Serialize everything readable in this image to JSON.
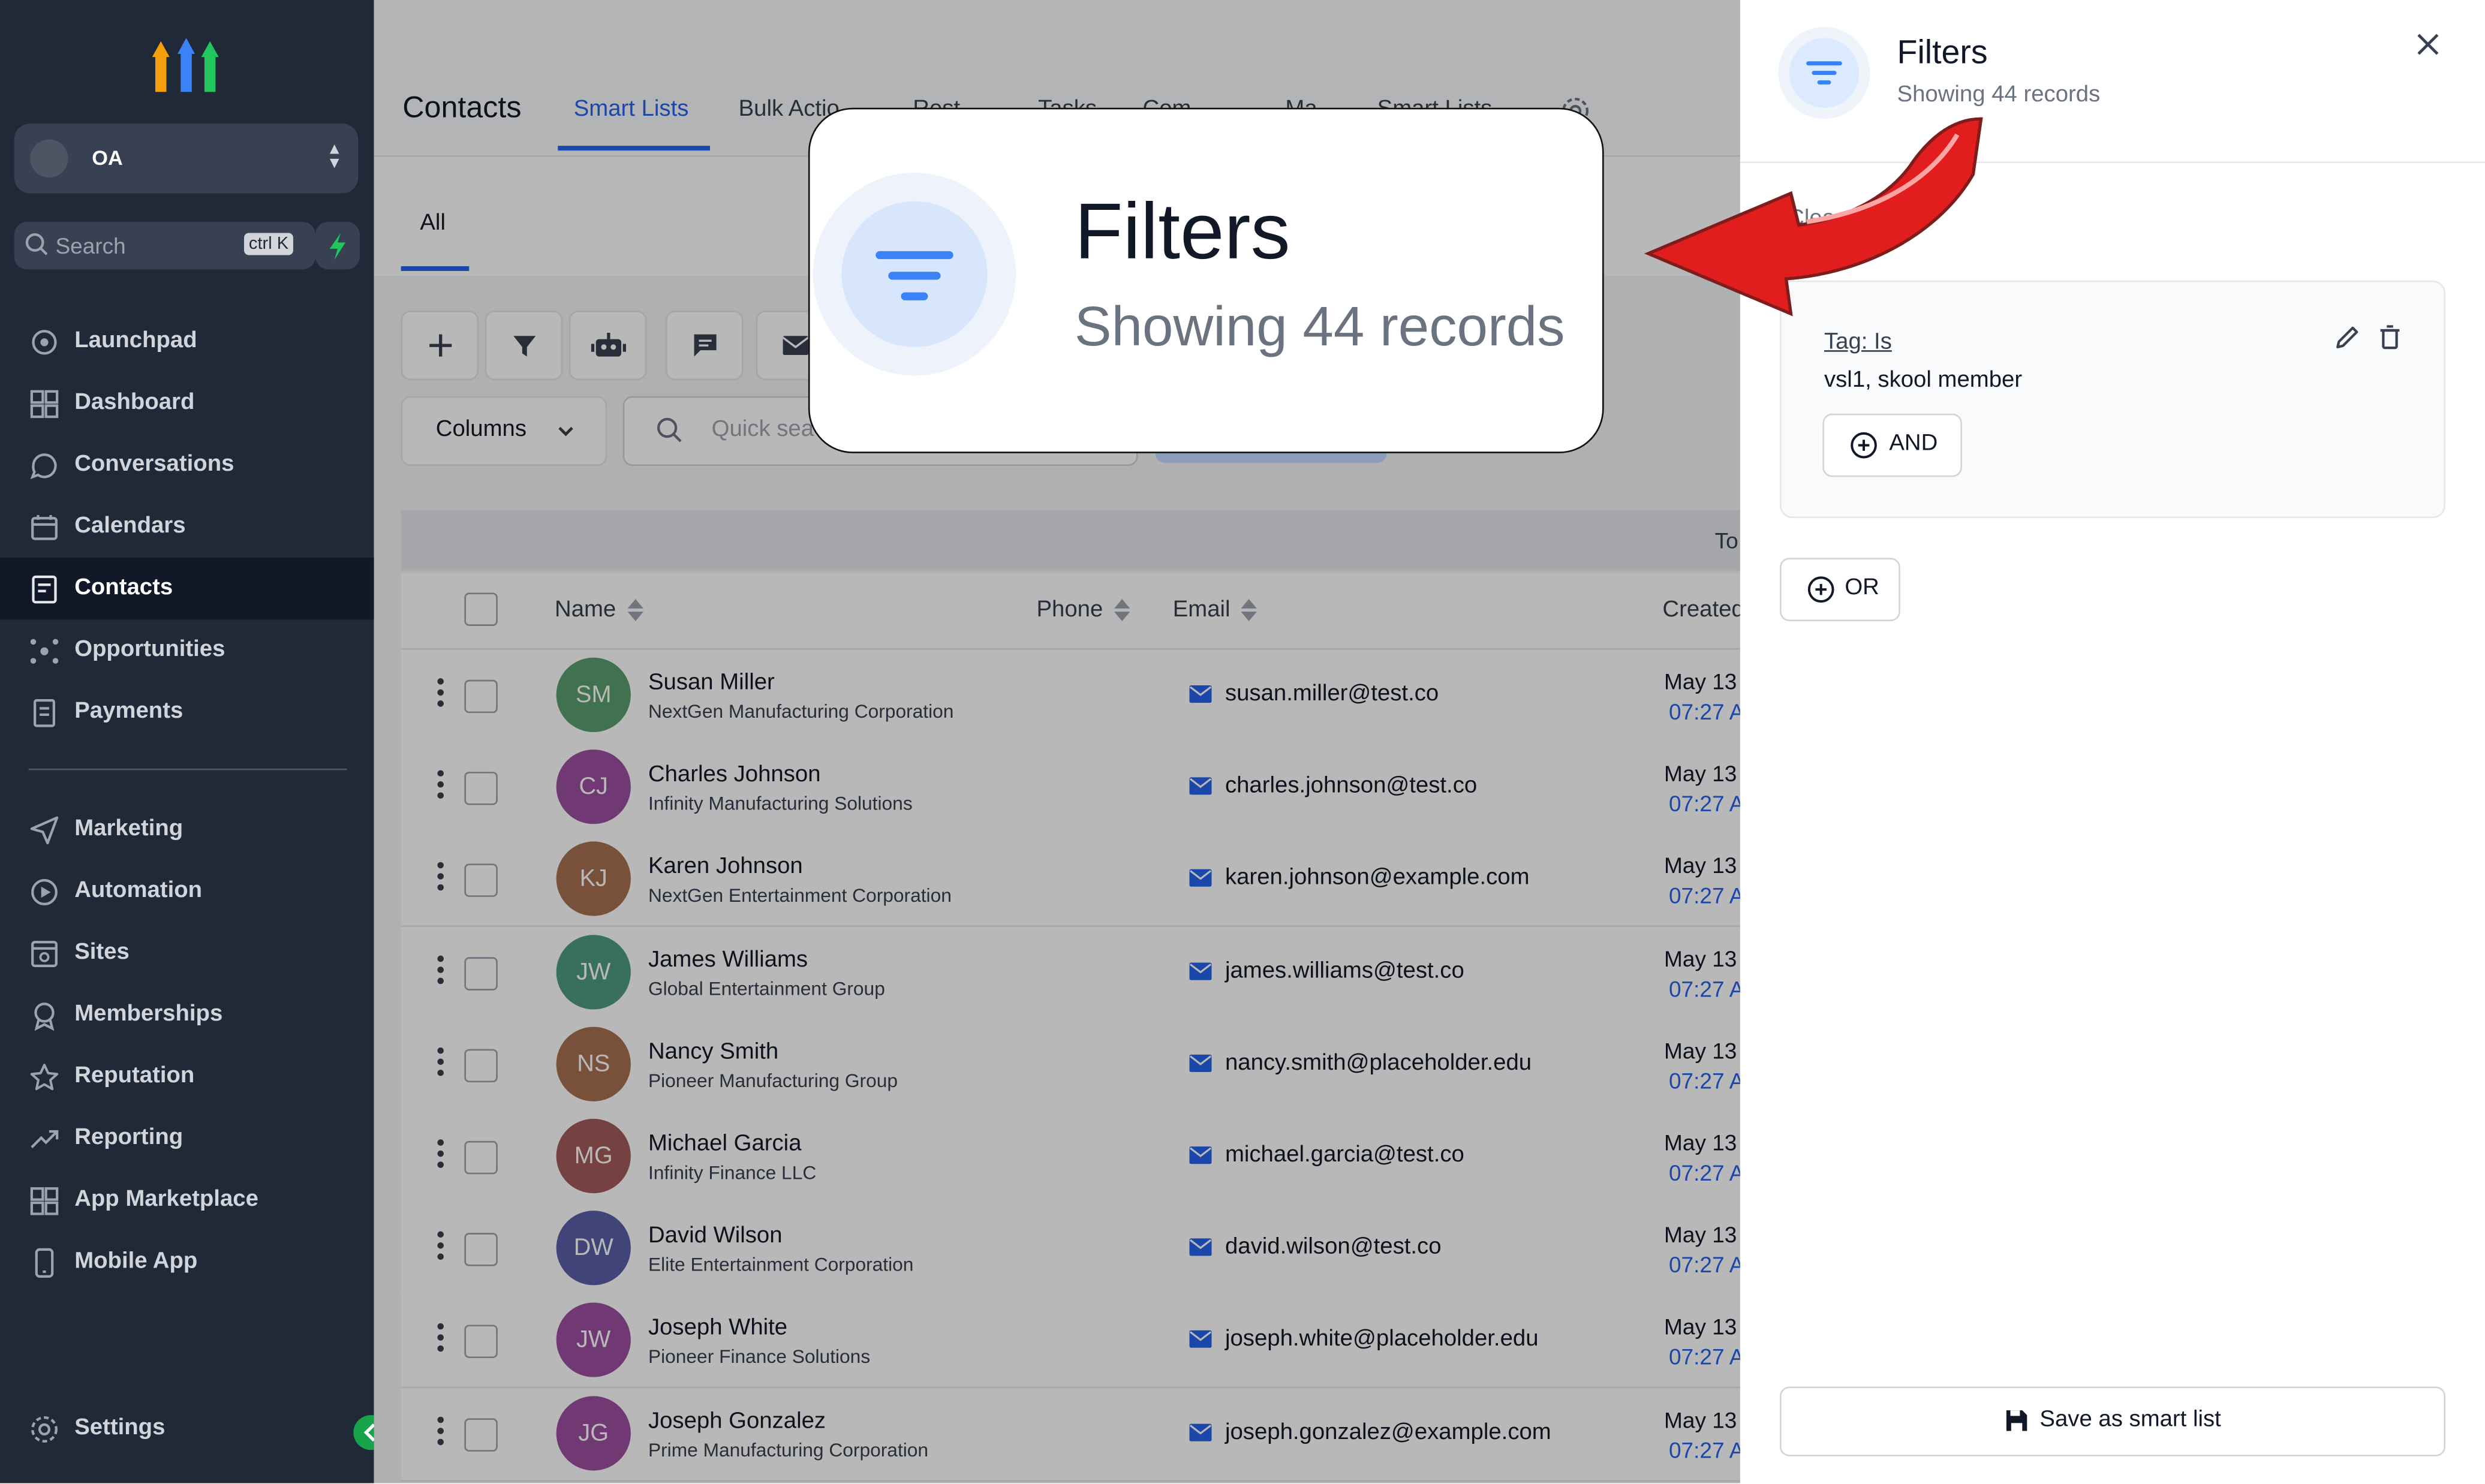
{
  "sidebar": {
    "account": "OA",
    "search_placeholder": "Search",
    "search_shortcut": "ctrl K",
    "items": [
      {
        "label": "Launchpad"
      },
      {
        "label": "Dashboard"
      },
      {
        "label": "Conversations"
      },
      {
        "label": "Calendars"
      },
      {
        "label": "Contacts"
      },
      {
        "label": "Opportunities"
      },
      {
        "label": "Payments"
      },
      {
        "label": "Marketing"
      },
      {
        "label": "Automation"
      },
      {
        "label": "Sites"
      },
      {
        "label": "Memberships"
      },
      {
        "label": "Reputation"
      },
      {
        "label": "Reporting"
      },
      {
        "label": "App Marketplace"
      },
      {
        "label": "Mobile App"
      }
    ],
    "settings": "Settings",
    "active_item": "Contacts"
  },
  "header": {
    "title": "Contacts",
    "tabs": [
      "Smart Lists",
      "Bulk Actio",
      "Rest",
      "Tasks",
      "Com",
      "Ma",
      "Smart Lists"
    ],
    "active_tab": "Smart Lists"
  },
  "subtab": {
    "label": "All"
  },
  "toolbar": {
    "columns_label": "Columns",
    "quick_search_placeholder": "Quick sea",
    "total_label": "To"
  },
  "table": {
    "headers": {
      "name": "Name",
      "phone": "Phone",
      "email": "Email",
      "created": "Created"
    },
    "rows": [
      {
        "initials": "SM",
        "name": "Susan Miller",
        "company": "NextGen Manufacturing Corporation",
        "email": "susan.miller@test.co",
        "date": "May 13",
        "time": "07:27 A",
        "color": "#5b9e6e"
      },
      {
        "initials": "CJ",
        "name": "Charles Johnson",
        "company": "Infinity Manufacturing Solutions",
        "email": "charles.johnson@test.co",
        "date": "May 13",
        "time": "07:27 A",
        "color": "#9b4fa0"
      },
      {
        "initials": "KJ",
        "name": "Karen Johnson",
        "company": "NextGen Entertainment Corporation",
        "email": "karen.johnson@example.com",
        "date": "May 13",
        "time": "07:27 A",
        "color": "#a8704f"
      },
      {
        "initials": "JW",
        "name": "James Williams",
        "company": "Global Entertainment Group",
        "email": "james.williams@test.co",
        "date": "May 13",
        "time": "07:27 A",
        "color": "#4f9a82"
      },
      {
        "initials": "NS",
        "name": "Nancy Smith",
        "company": "Pioneer Manufacturing Group",
        "email": "nancy.smith@placeholder.edu",
        "date": "May 13",
        "time": "07:27 A",
        "color": "#a8704f"
      },
      {
        "initials": "MG",
        "name": "Michael Garcia",
        "company": "Infinity Finance LLC",
        "email": "michael.garcia@test.co",
        "date": "May 13",
        "time": "07:27 A",
        "color": "#a35a5a"
      },
      {
        "initials": "DW",
        "name": "David Wilson",
        "company": "Elite Entertainment Corporation",
        "email": "david.wilson@test.co",
        "date": "May 13",
        "time": "07:27 A",
        "color": "#5a5fa8"
      },
      {
        "initials": "JW",
        "name": "Joseph White",
        "company": "Pioneer Finance Solutions",
        "email": "joseph.white@placeholder.edu",
        "date": "May 13",
        "time": "07:27 A",
        "color": "#9b4fa0"
      },
      {
        "initials": "JG",
        "name": "Joseph Gonzalez",
        "company": "Prime Manufacturing Corporation",
        "email": "joseph.gonzalez@example.com",
        "date": "May 13",
        "time": "07:27 A",
        "color": "#9b4fa0"
      }
    ]
  },
  "panel": {
    "title": "Filters",
    "subtitle": "Showing 44 records",
    "clear_label": "Clear all filters",
    "filter": {
      "label": "Tag: Is",
      "value": "vsl1, skool member"
    },
    "and_label": "AND",
    "or_label": "OR",
    "save_label": "Save as smart list"
  },
  "callout": {
    "title": "Filters",
    "subtitle": "Showing 44 records"
  },
  "colors": {
    "accent": "#2563eb",
    "sidebar": "#1f2937",
    "arrow": "#e11d1d"
  }
}
